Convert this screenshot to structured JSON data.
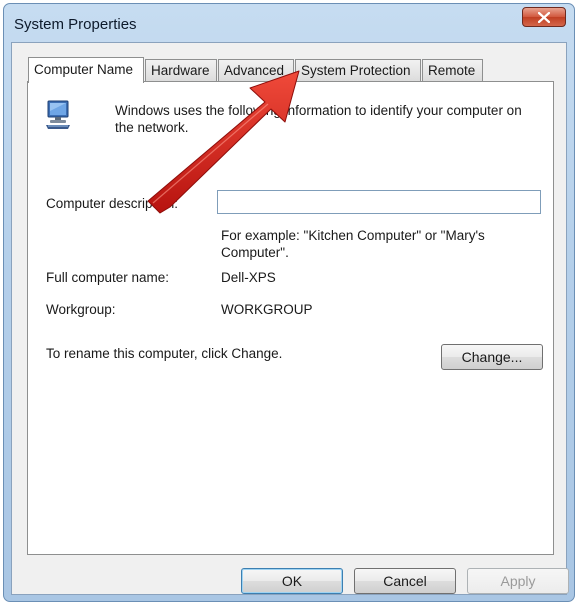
{
  "window": {
    "title": "System Properties"
  },
  "tabs": [
    {
      "label": "Computer Name"
    },
    {
      "label": "Hardware"
    },
    {
      "label": "Advanced"
    },
    {
      "label": "System Protection"
    },
    {
      "label": "Remote"
    }
  ],
  "panel": {
    "intro_line1": "Windows uses the following information to identify your computer on",
    "intro_line2": "the network.",
    "description_label": "Computer description:",
    "description_value": "",
    "example_line1": "For example: \"Kitchen Computer\" or \"Mary's",
    "example_line2": "Computer\".",
    "full_name_label": "Full computer name:",
    "full_name_value": "Dell-XPS",
    "workgroup_label": "Workgroup:",
    "workgroup_value": "WORKGROUP",
    "rename_text": "To rename this computer, click Change.",
    "change_label": "Change..."
  },
  "footer": {
    "ok_label": "OK",
    "cancel_label": "Cancel",
    "apply_label": "Apply"
  },
  "colors": {
    "annotation_arrow": "#d8201e",
    "title_bar": "#b4cfea",
    "close_button": "#c8472b"
  }
}
